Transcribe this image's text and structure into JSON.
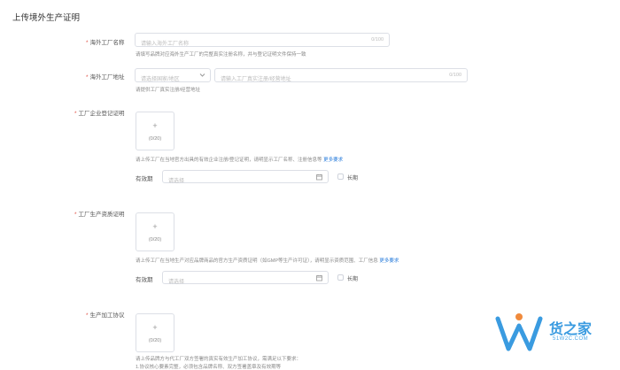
{
  "section_title": "上传境外生产证明",
  "factory_name": {
    "required": "*",
    "label": "海外工厂名称",
    "placeholder": "请输入海外工厂名称",
    "counter": "0/100",
    "hint": "请填写品牌对应海外生产工厂的完整真实注册名称，并与登记证明文件保持一致"
  },
  "factory_address": {
    "required": "*",
    "label": "海外工厂地址",
    "country_placeholder": "请选择国家/地区",
    "address_placeholder": "请输入工厂真实注册/经营地址",
    "counter": "0/100",
    "hint": "请提供工厂真实注册/经营地址"
  },
  "registration_cert": {
    "required": "*",
    "label": "工厂企业登记证明",
    "upload_plus": "+",
    "upload_count": "(0/20)",
    "hint": "请上传工厂在当地官方出具的有效企业注册/登记证明，请明显示工厂名称、注册信息等",
    "more": "更多要求",
    "validity_label": "有效期",
    "date_placeholder": "请选择",
    "long_term": "长期"
  },
  "production_cert": {
    "required": "*",
    "label": "工厂生产资质证明",
    "upload_plus": "+",
    "upload_count": "(0/20)",
    "hint": "请上传工厂在当地生产对应品牌商品的官方生产资质证明（如GMP等生产许可证），请明显示资质范围、工厂信息",
    "more": "更多要求",
    "validity_label": "有效期",
    "date_placeholder": "请选择",
    "long_term": "长期"
  },
  "processing_agreement": {
    "required": "*",
    "label": "生产加工协议",
    "upload_plus": "+",
    "upload_count": "(0/20)",
    "hint": "请上传品牌方与代工厂双方签署的真实有效生产加工协议，需满足以下要求：",
    "hint2": "1.协议核心要素完整，必须包含品牌名称、双方签署盖章及有效期等"
  },
  "watermark": {
    "text": "货之家",
    "sub": "51W2C.COM"
  },
  "colors": {
    "link": "#2d7fdc",
    "required": "#e0554a",
    "watermark": "#3a9be0"
  }
}
